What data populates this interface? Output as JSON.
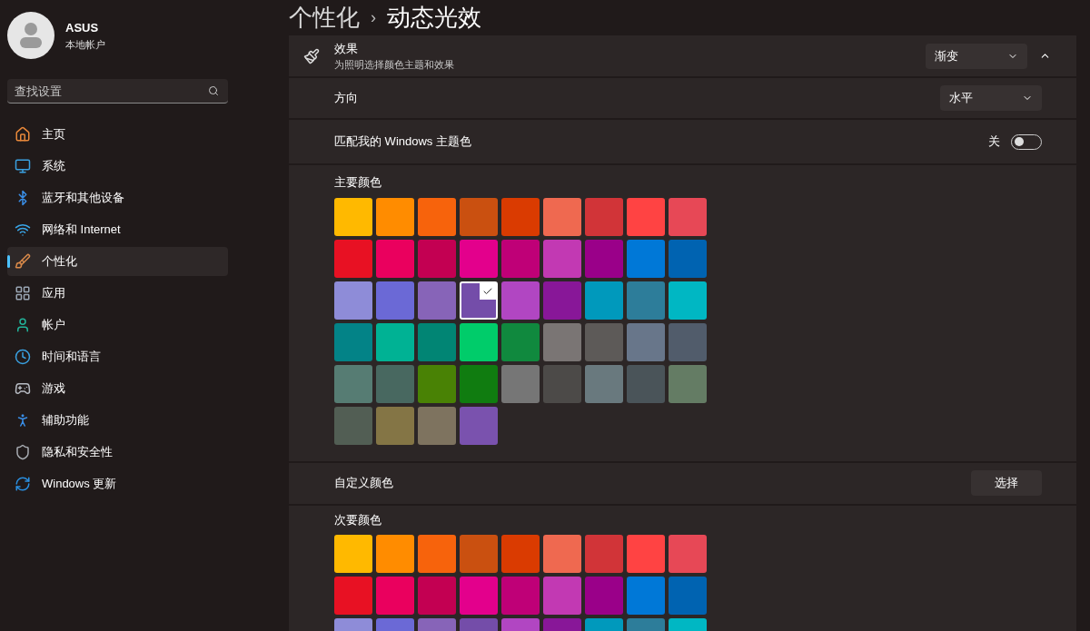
{
  "account": {
    "name": "ASUS",
    "type": "本地帐户"
  },
  "search": {
    "placeholder": "查找设置"
  },
  "nav": [
    {
      "label": "主页",
      "kind": "home",
      "selected": false
    },
    {
      "label": "系统",
      "kind": "system",
      "selected": false
    },
    {
      "label": "蓝牙和其他设备",
      "kind": "bluetooth",
      "selected": false
    },
    {
      "label": "网络和 Internet",
      "kind": "network",
      "selected": false
    },
    {
      "label": "个性化",
      "kind": "brush",
      "selected": true
    },
    {
      "label": "应用",
      "kind": "apps",
      "selected": false
    },
    {
      "label": "帐户",
      "kind": "account",
      "selected": false
    },
    {
      "label": "时间和语言",
      "kind": "time",
      "selected": false
    },
    {
      "label": "游戏",
      "kind": "gaming",
      "selected": false
    },
    {
      "label": "辅助功能",
      "kind": "accessibility",
      "selected": false
    },
    {
      "label": "隐私和安全性",
      "kind": "privacy",
      "selected": false
    },
    {
      "label": "Windows 更新",
      "kind": "update",
      "selected": false
    }
  ],
  "breadcrumb": {
    "parent": "个性化",
    "separator": "›",
    "current": "动态光效"
  },
  "effect": {
    "title": "效果",
    "description": "为照明选择颜色主题和效果",
    "value": "渐变",
    "expanded": true
  },
  "direction": {
    "label": "方向",
    "value": "水平"
  },
  "match_theme": {
    "label": "匹配我的 Windows 主题色",
    "state_label": "关",
    "on": false
  },
  "primary": {
    "title": "主要颜色",
    "swatches": [
      {
        "color": "#ffb900",
        "selected": false
      },
      {
        "color": "#ff8c00",
        "selected": false
      },
      {
        "color": "#f7630c",
        "selected": false
      },
      {
        "color": "#ca5010",
        "selected": false
      },
      {
        "color": "#da3b01",
        "selected": false
      },
      {
        "color": "#ef6950",
        "selected": false
      },
      {
        "color": "#d13438",
        "selected": false
      },
      {
        "color": "#ff4343",
        "selected": false
      },
      {
        "color": "#e74856",
        "selected": false
      },
      {
        "color": "#e81123",
        "selected": false
      },
      {
        "color": "#ea005e",
        "selected": false
      },
      {
        "color": "#c30052",
        "selected": false
      },
      {
        "color": "#e3008c",
        "selected": false
      },
      {
        "color": "#bf0077",
        "selected": false
      },
      {
        "color": "#c239b3",
        "selected": false
      },
      {
        "color": "#9a0089",
        "selected": false
      },
      {
        "color": "#0078d7",
        "selected": false
      },
      {
        "color": "#0063b1",
        "selected": false
      },
      {
        "color": "#8e8cd8",
        "selected": false
      },
      {
        "color": "#6b69d6",
        "selected": false
      },
      {
        "color": "#8764b8",
        "selected": false
      },
      {
        "color": "#744da9",
        "selected": true
      },
      {
        "color": "#b146c2",
        "selected": false
      },
      {
        "color": "#881798",
        "selected": false
      },
      {
        "color": "#0099bc",
        "selected": false
      },
      {
        "color": "#2d7d9a",
        "selected": false
      },
      {
        "color": "#00b7c3",
        "selected": false
      },
      {
        "color": "#038387",
        "selected": false
      },
      {
        "color": "#00b294",
        "selected": false
      },
      {
        "color": "#018574",
        "selected": false
      },
      {
        "color": "#00cc6a",
        "selected": false
      },
      {
        "color": "#10893e",
        "selected": false
      },
      {
        "color": "#7a7574",
        "selected": false
      },
      {
        "color": "#5d5a58",
        "selected": false
      },
      {
        "color": "#68768a",
        "selected": false
      },
      {
        "color": "#515c6b",
        "selected": false
      },
      {
        "color": "#567c73",
        "selected": false
      },
      {
        "color": "#486860",
        "selected": false
      },
      {
        "color": "#498205",
        "selected": false
      },
      {
        "color": "#107c10",
        "selected": false
      },
      {
        "color": "#767676",
        "selected": false
      },
      {
        "color": "#4c4a48",
        "selected": false
      },
      {
        "color": "#69797e",
        "selected": false
      },
      {
        "color": "#4a5459",
        "selected": false
      },
      {
        "color": "#647c64",
        "selected": false
      },
      {
        "color": "#525e54",
        "selected": false
      },
      {
        "color": "#847545",
        "selected": false
      },
      {
        "color": "#7e735f",
        "selected": false
      },
      {
        "color": "#7a52ae",
        "selected": false
      }
    ]
  },
  "custom_color": {
    "label": "自定义颜色",
    "button": "选择"
  },
  "secondary": {
    "title": "次要颜色",
    "swatches": [
      {
        "color": "#ffb900",
        "selected": false
      },
      {
        "color": "#ff8c00",
        "selected": false
      },
      {
        "color": "#f7630c",
        "selected": false
      },
      {
        "color": "#ca5010",
        "selected": false
      },
      {
        "color": "#da3b01",
        "selected": false
      },
      {
        "color": "#ef6950",
        "selected": false
      },
      {
        "color": "#d13438",
        "selected": false
      },
      {
        "color": "#ff4343",
        "selected": false
      },
      {
        "color": "#e74856",
        "selected": false
      },
      {
        "color": "#e81123",
        "selected": false
      },
      {
        "color": "#ea005e",
        "selected": false
      },
      {
        "color": "#c30052",
        "selected": false
      },
      {
        "color": "#e3008c",
        "selected": false
      },
      {
        "color": "#bf0077",
        "selected": false
      },
      {
        "color": "#c239b3",
        "selected": false
      },
      {
        "color": "#9a0089",
        "selected": false
      },
      {
        "color": "#0078d7",
        "selected": false
      },
      {
        "color": "#0063b1",
        "selected": false
      },
      {
        "color": "#8e8cd8",
        "selected": false
      },
      {
        "color": "#6b69d6",
        "selected": false
      },
      {
        "color": "#8764b8",
        "selected": false
      },
      {
        "color": "#744da9",
        "selected": false
      },
      {
        "color": "#b146c2",
        "selected": false
      },
      {
        "color": "#881798",
        "selected": false
      },
      {
        "color": "#0099bc",
        "selected": false
      },
      {
        "color": "#2d7d9a",
        "selected": false
      },
      {
        "color": "#00b7c3",
        "selected": false
      }
    ]
  }
}
